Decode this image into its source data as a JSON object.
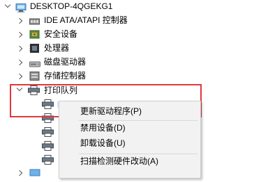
{
  "tree": {
    "computer_name": "DESKTOP-4QGEKG1",
    "items": [
      {
        "label": "IDE ATA/ATAPI 控制器",
        "icon": "ide-controller-icon"
      },
      {
        "label": "安全设备",
        "icon": "security-device-icon"
      },
      {
        "label": "处理器",
        "icon": "processor-icon"
      },
      {
        "label": "磁盘驱动器",
        "icon": "disk-drive-icon"
      },
      {
        "label": "存储控制器",
        "icon": "storage-controller-icon"
      },
      {
        "label": "打印队列",
        "icon": "printer-icon"
      }
    ]
  },
  "context_menu": {
    "items": [
      {
        "label": "更新驱动程序(P)"
      },
      {
        "label": "禁用设备(D)"
      },
      {
        "label": "卸载设备(U)"
      },
      {
        "label": "扫描检测硬件改动(A)"
      }
    ]
  },
  "colors": {
    "highlight_border": "#e0383c",
    "menu_bg": "#f2f2f2",
    "menu_hover": "#dadada"
  }
}
